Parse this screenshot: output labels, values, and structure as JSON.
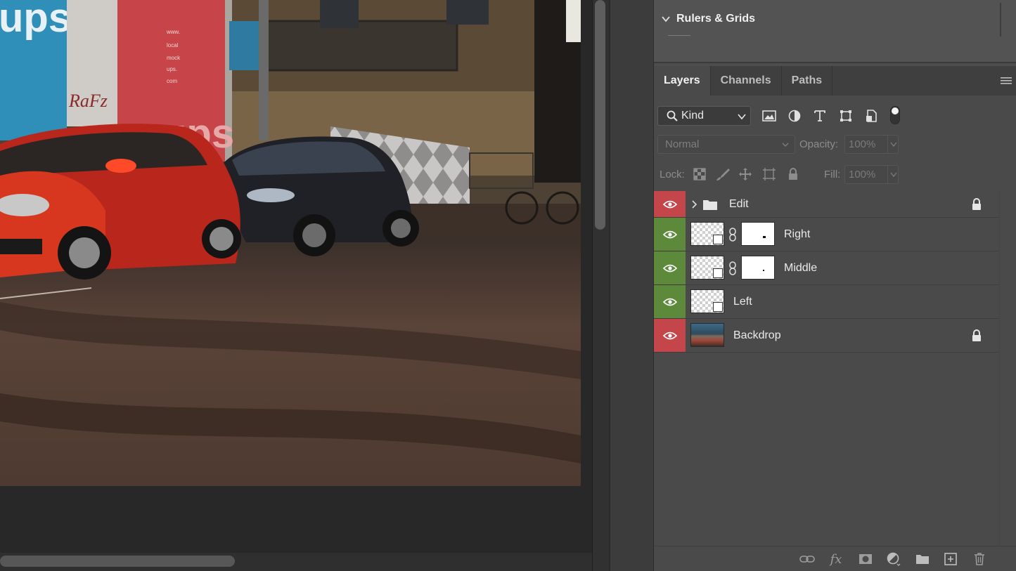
{
  "rulers_panel": {
    "title": "Rulers & Grids"
  },
  "layers_panel": {
    "tabs": [
      {
        "label": "Layers",
        "active": true
      },
      {
        "label": "Channels",
        "active": false
      },
      {
        "label": "Paths",
        "active": false
      }
    ],
    "filter": {
      "kind_label": "Kind",
      "icons": [
        "image-filter-icon",
        "adjustment-filter-icon",
        "type-filter-icon",
        "shape-filter-icon",
        "smart-object-filter-icon"
      ]
    },
    "blend_mode": "Normal",
    "opacity_label": "Opacity:",
    "opacity_value": "100%",
    "lock_label": "Lock:",
    "fill_label": "Fill:",
    "fill_value": "100%",
    "layers": [
      {
        "name": "Edit",
        "type": "group",
        "visibility_color": "red",
        "locked": true
      },
      {
        "name": "Right",
        "type": "smart-object-with-mask",
        "visibility_color": "green",
        "locked": false
      },
      {
        "name": "Middle",
        "type": "smart-object-with-mask",
        "visibility_color": "green",
        "locked": false
      },
      {
        "name": "Left",
        "type": "smart-object",
        "visibility_color": "green",
        "locked": false
      },
      {
        "name": "Backdrop",
        "type": "image",
        "visibility_color": "red",
        "locked": true
      }
    ],
    "bottom_icons": [
      "link-layers-icon",
      "fx-icon",
      "add-mask-icon",
      "adjustment-layer-icon",
      "new-group-icon",
      "new-layer-icon",
      "trash-icon"
    ]
  },
  "canvas": {
    "poster_text": [
      "www.",
      "local",
      "mock",
      "ups.",
      "com"
    ],
    "sign_text_left": "ups",
    "sign_text_right": "ups"
  },
  "colors": {
    "eye_red": "#c5464a",
    "eye_green": "#5c8a3a",
    "panel_bg": "#4a4a4a"
  }
}
